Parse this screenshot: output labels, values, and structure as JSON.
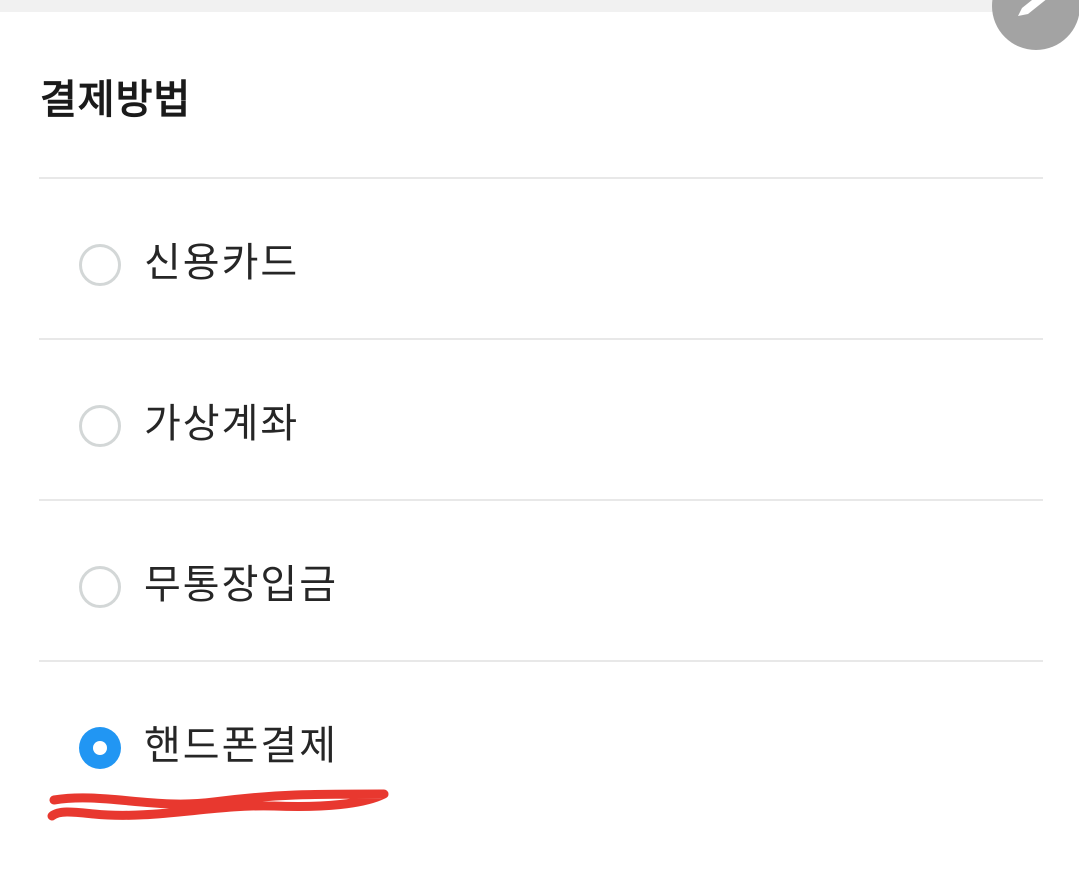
{
  "payment": {
    "title": "결제방법",
    "options": [
      {
        "label": "신용카드",
        "selected": false
      },
      {
        "label": "가상계좌",
        "selected": false
      },
      {
        "label": "무통장입금",
        "selected": false
      },
      {
        "label": "핸드폰결제",
        "selected": true
      }
    ]
  },
  "colors": {
    "radio_selected": "#2196f3",
    "radio_border": "#d3d7d7",
    "annotation": "#e8382f"
  },
  "icons": {
    "fab": "pencil-icon"
  }
}
